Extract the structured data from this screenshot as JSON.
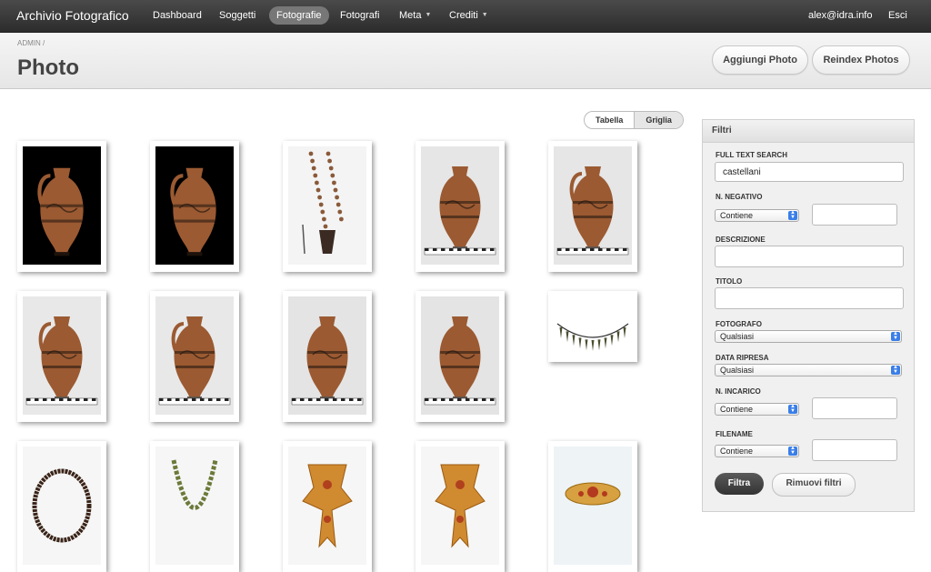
{
  "navbar": {
    "brand": "Archivio Fotografico",
    "items": [
      {
        "label": "Dashboard",
        "active": false,
        "dropdown": false
      },
      {
        "label": "Soggetti",
        "active": false,
        "dropdown": false
      },
      {
        "label": "Fotografie",
        "active": true,
        "dropdown": false
      },
      {
        "label": "Fotografi",
        "active": false,
        "dropdown": false
      },
      {
        "label": "Meta",
        "active": false,
        "dropdown": true
      },
      {
        "label": "Crediti",
        "active": false,
        "dropdown": true
      }
    ],
    "user_email": "alex@idra.info",
    "logout_label": "Esci"
  },
  "header": {
    "breadcrumb": "ADMIN",
    "breadcrumb_sep": "/",
    "title": "Photo",
    "add_button": "Aggiungi Photo",
    "reindex_button": "Reindex Photos"
  },
  "view_toggle": {
    "table_label": "Tabella",
    "grid_label": "Griglia",
    "selected": "Griglia"
  },
  "photos": [
    {
      "subject": "black-figure-oinochoe",
      "background": "#000000"
    },
    {
      "subject": "black-figure-oinochoe",
      "background": "#000000"
    },
    {
      "subject": "bead-necklace-with-pendant",
      "background": "#f4f4f4"
    },
    {
      "subject": "amphora-with-scale",
      "background": "#e6e6e6"
    },
    {
      "subject": "oinochoe-with-scale",
      "background": "#e6e6e6"
    },
    {
      "subject": "oinochoe-with-scale",
      "background": "#e8e8e8"
    },
    {
      "subject": "oinochoe-with-scale",
      "background": "#e8e8e8"
    },
    {
      "subject": "amphora-with-scale",
      "background": "#e4e4e4"
    },
    {
      "subject": "amphora-with-scale",
      "background": "#e4e4e4"
    },
    {
      "subject": "pendant-necklace",
      "background": "#ffffff"
    },
    {
      "subject": "bead-ring-necklace",
      "background": "#f6f6f6"
    },
    {
      "subject": "bead-necklace",
      "background": "#f6f6f6"
    },
    {
      "subject": "gold-fibula",
      "background": "#f6f6f6"
    },
    {
      "subject": "gold-fibula",
      "background": "#f6f6f6"
    },
    {
      "subject": "gold-ring",
      "background": "#eef3f6"
    }
  ],
  "filters": {
    "title": "Filtri",
    "fulltext_label": "FULL TEXT SEARCH",
    "fulltext_value": "castellani",
    "negativo_label": "N. NEGATIVO",
    "negativo_op": "Contiene",
    "negativo_value": "",
    "descrizione_label": "DESCRIZIONE",
    "descrizione_value": "",
    "titolo_label": "TITOLO",
    "titolo_value": "",
    "fotografo_label": "FOTOGRAFO",
    "fotografo_value": "Qualsiasi",
    "data_label": "DATA RIPRESA",
    "data_value": "Qualsiasi",
    "incarico_label": "N. INCARICO",
    "incarico_op": "Contiene",
    "incarico_value": "",
    "filename_label": "FILENAME",
    "filename_op": "Contiene",
    "filename_value": "",
    "submit": "Filtra",
    "reset": "Rimuovi filtri"
  },
  "colors": {
    "navbar_bg": "#333333",
    "active_nav": "#777777",
    "primary_button": "#444444",
    "select_arrow": "#3a7ee8",
    "pottery": "#a0522d"
  }
}
